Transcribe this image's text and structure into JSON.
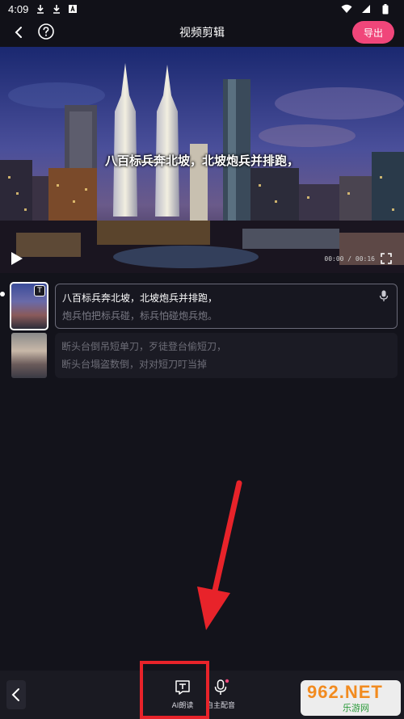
{
  "status_bar": {
    "time": "4:09",
    "icons": [
      "download-icon",
      "download-icon",
      "text-icon",
      "wifi-icon",
      "signal-icon",
      "battery-icon"
    ]
  },
  "header": {
    "title": "视频剪辑",
    "export_label": "导出"
  },
  "player": {
    "subtitle": "八百标兵奔北坡，北坡炮兵并排跑，",
    "timecode": "00:00 / 00:16"
  },
  "clips": [
    {
      "badge": "T",
      "line1": "八百标兵奔北坡，北坡炮兵并排跑，",
      "line2": "炮兵怕把标兵碰，标兵怕碰炮兵炮。"
    },
    {
      "line1": "断头台倒吊短单刀，歹徒登台偷短刀，",
      "line2": "断头台塌盗数倒，对对短刀叮当掉"
    }
  ],
  "toolbar": {
    "ai_read_label": "AI朗读",
    "voiceover_label": "自主配音"
  },
  "watermark": {
    "brand": "962.NET",
    "site": "乐游网"
  },
  "colors": {
    "accent": "#f0467a",
    "highlight": "#e8232a",
    "background": "#13131b"
  }
}
